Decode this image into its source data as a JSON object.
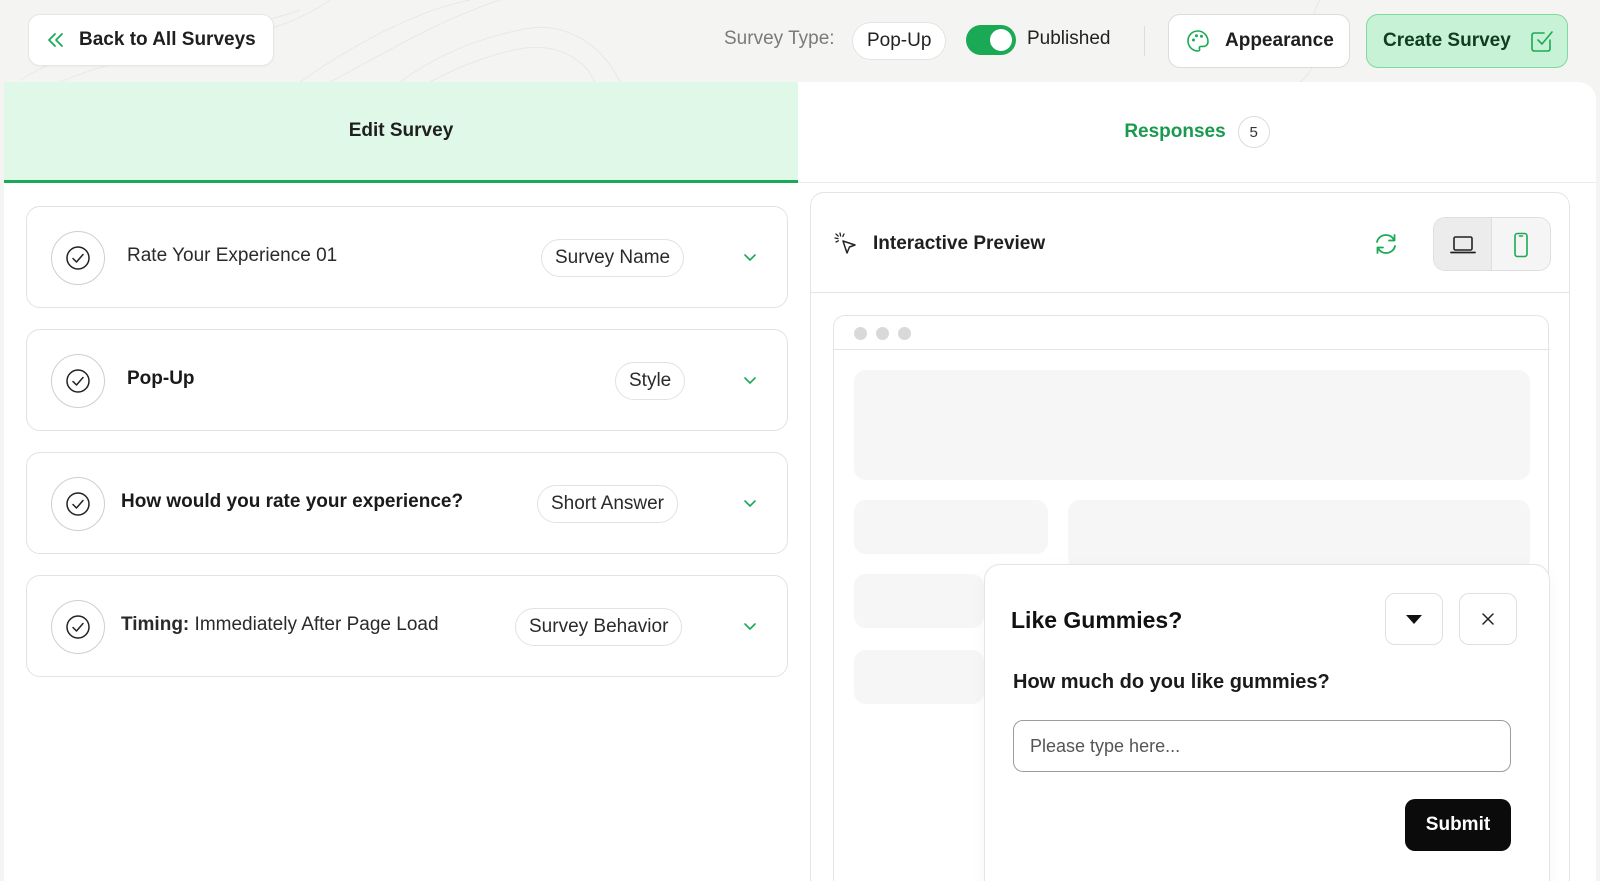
{
  "header": {
    "back_label": "Back to All Surveys",
    "survey_type_label": "Survey Type:",
    "survey_type_value": "Pop-Up",
    "published_label": "Published",
    "published": true,
    "appearance_label": "Appearance",
    "create_label": "Create Survey"
  },
  "tabs": {
    "edit_label": "Edit Survey",
    "responses_label": "Responses",
    "responses_count": "5"
  },
  "sections": [
    {
      "title": "Rate Your Experience 01",
      "tag": "Survey Name"
    },
    {
      "title": "Pop-Up",
      "tag": "Style"
    },
    {
      "title": "How would you rate your experience?",
      "tag": "Short Answer"
    },
    {
      "title_prefix": "Timing:",
      "title": " Immediately After Page Load",
      "tag": "Survey Behavior"
    }
  ],
  "preview": {
    "title": "Interactive Preview",
    "popup": {
      "title": "Like Gummies?",
      "question": "How much do you like gummies?",
      "input_placeholder": "Please type here...",
      "submit_label": "Submit"
    }
  },
  "colors": {
    "accent": "#1aaa55",
    "accent_light": "#dff8e7",
    "create_bg": "#c8f2d6",
    "text": "#1c1c1c"
  },
  "icons": {
    "back": "chevrons-left-icon",
    "appearance": "palette-icon",
    "create": "square-check-icon",
    "section_status": "circle-check-icon",
    "expand": "chevron-down-icon",
    "preview": "pointer-click-icon",
    "refresh": "refresh-icon",
    "desktop": "laptop-icon",
    "mobile": "smartphone-icon",
    "collapse": "caret-down-icon",
    "close": "close-icon"
  }
}
